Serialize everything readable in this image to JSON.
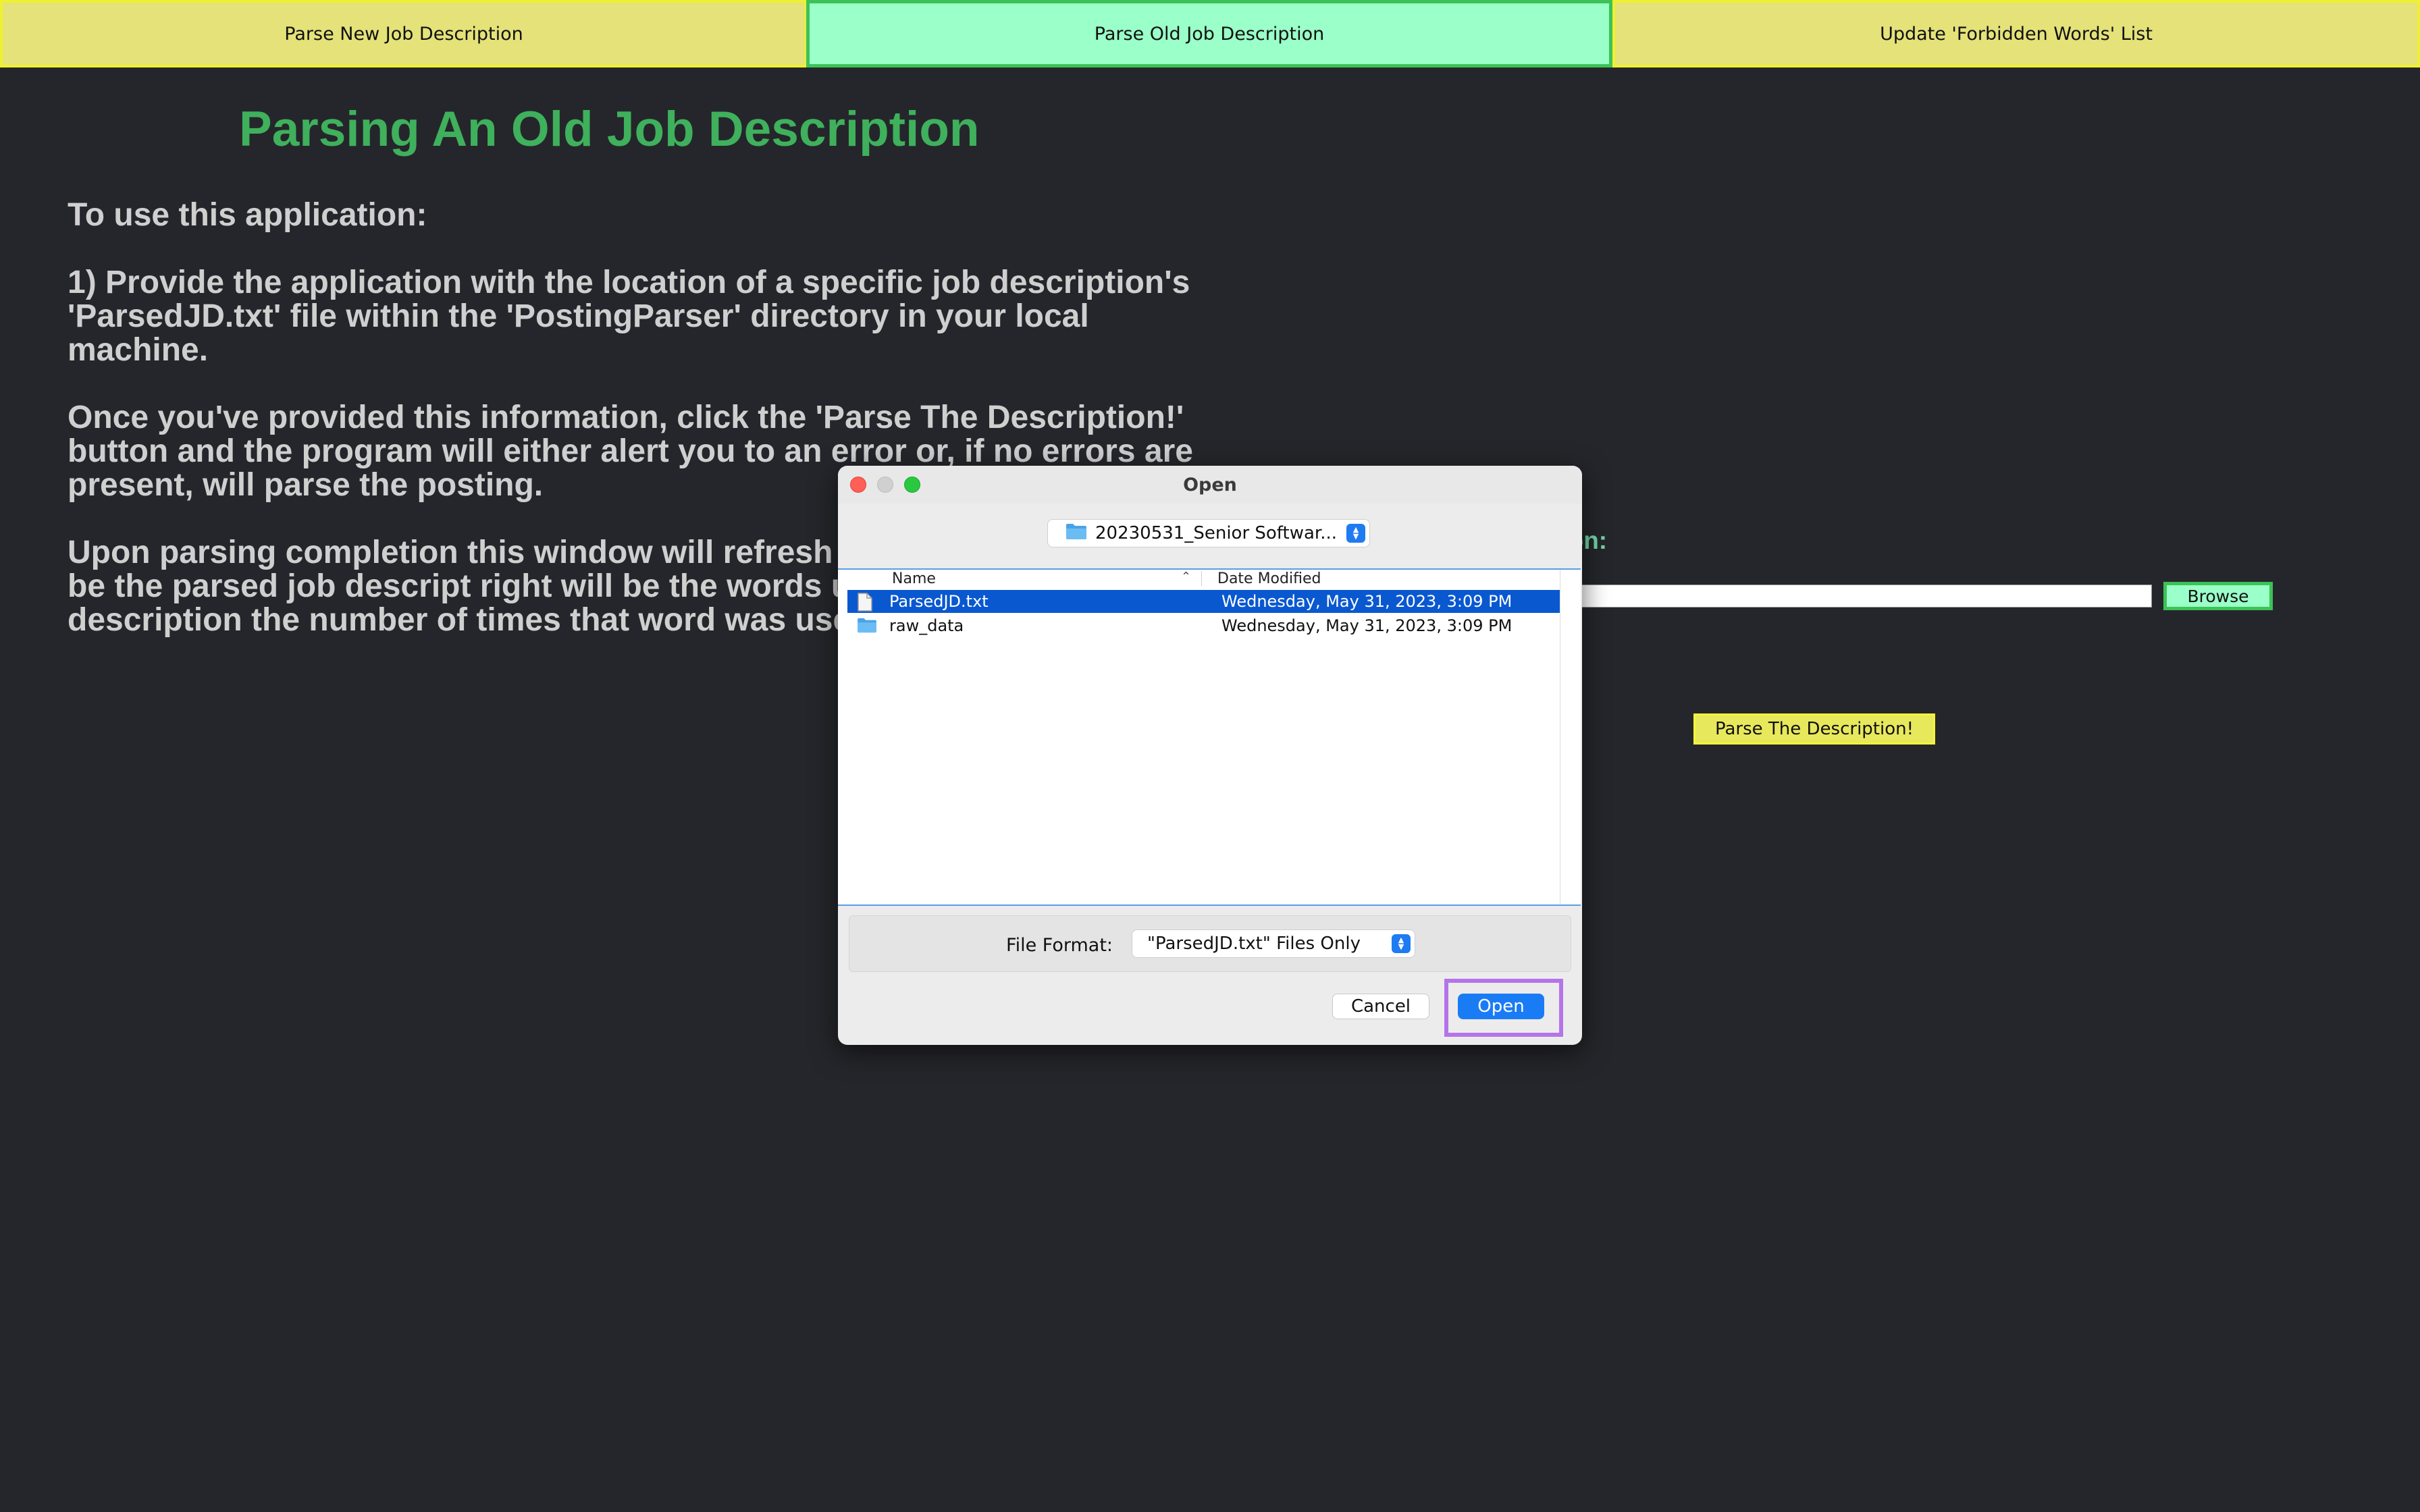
{
  "tabs": [
    {
      "label": "Parse New Job Description",
      "active": false
    },
    {
      "label": "Parse Old Job Description",
      "active": true
    },
    {
      "label": "Update 'Forbidden Words' List",
      "active": false
    }
  ],
  "main": {
    "title": "Parsing An Old Job Description",
    "instructions": [
      "To use this application:",
      "1) Provide the application with the location of a specific job description's 'ParsedJD.txt' file within the 'PostingParser' directory in your local machine.",
      "Once you've provided this information, click the 'Parse The Description!' button and the program will either alert you to an error or, if no errors are present, will parse the posting.",
      "Upon parsing completion this window will refresh display - on the left will be the parsed job descript right will be the words used in the job description the number of times that word was used in the po"
    ],
    "right_label_visible": "tion:",
    "path_value": "",
    "browse_label": "Browse",
    "parse_label": "Parse The Description!"
  },
  "dialog": {
    "title": "Open",
    "folder": "20230531_Senior Softwar...",
    "columns": {
      "name": "Name",
      "date": "Date Modified"
    },
    "files": [
      {
        "name": "ParsedJD.txt",
        "date": "Wednesday, May 31, 2023, 3:09 PM",
        "type": "file",
        "selected": true
      },
      {
        "name": "raw_data",
        "date": "Wednesday, May 31, 2023, 3:09 PM",
        "type": "folder",
        "selected": false
      }
    ],
    "format_label": "File Format:",
    "format_value": "\"ParsedJD.txt\" Files Only",
    "cancel_label": "Cancel",
    "open_label": "Open"
  },
  "colors": {
    "background": "#25262b",
    "tab_inactive": "#e4e279",
    "tab_active": "#9affc8",
    "title_green": "#3fb05c",
    "selection_blue": "#0a58d0",
    "highlight_outline": "#b474ea"
  },
  "icons": {
    "folder": "folder-icon",
    "file": "document-icon",
    "stepper": "up-down-chevron-icon",
    "sort": "chevron-up-icon"
  }
}
